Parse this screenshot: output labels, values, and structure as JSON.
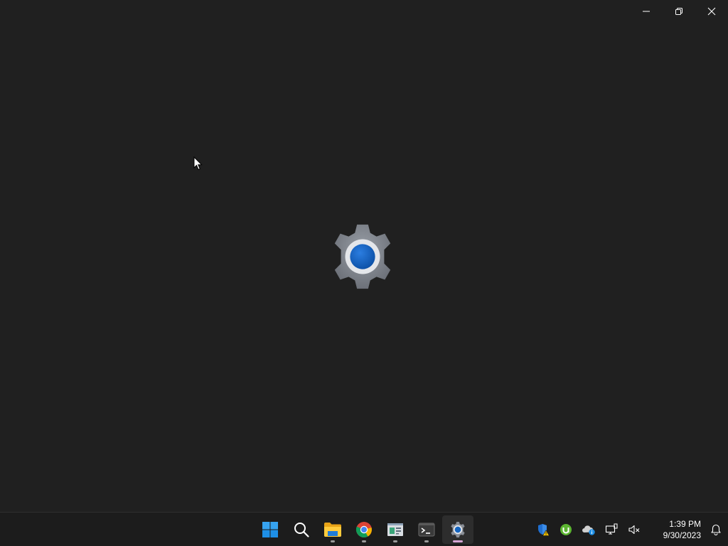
{
  "window": {
    "caption_buttons": [
      {
        "name": "minimize",
        "icon": "minimize-icon"
      },
      {
        "name": "restore",
        "icon": "restore-icon"
      },
      {
        "name": "close",
        "icon": "close-icon"
      }
    ]
  },
  "splash": {
    "icon": "settings-gear-icon",
    "colors": {
      "gear": "#7b7f88",
      "ring": "#e6e6e6",
      "center": "#1565c0"
    }
  },
  "taskbar": {
    "apps": [
      {
        "name": "start",
        "icon": "windows-logo-icon",
        "running": false,
        "active": false
      },
      {
        "name": "search",
        "icon": "search-icon",
        "running": false,
        "active": false
      },
      {
        "name": "file-explorer",
        "icon": "folder-icon",
        "running": true,
        "active": false
      },
      {
        "name": "chrome",
        "icon": "chrome-icon",
        "running": true,
        "active": false
      },
      {
        "name": "control-panel",
        "icon": "control-panel-icon",
        "running": true,
        "active": false
      },
      {
        "name": "terminal",
        "icon": "terminal-icon",
        "running": true,
        "active": false
      },
      {
        "name": "settings",
        "icon": "settings-gear-icon",
        "running": true,
        "active": true
      }
    ],
    "tray": [
      {
        "name": "windows-security",
        "icon": "shield-warning-icon"
      },
      {
        "name": "utorrent",
        "icon": "utorrent-icon"
      },
      {
        "name": "onedrive",
        "icon": "cloud-info-icon"
      },
      {
        "name": "network",
        "icon": "network-icon"
      },
      {
        "name": "volume",
        "icon": "speaker-muted-icon"
      }
    ],
    "clock": {
      "time": "1:39 PM",
      "date": "9/30/2023"
    },
    "notifications_icon": "bell-icon"
  }
}
